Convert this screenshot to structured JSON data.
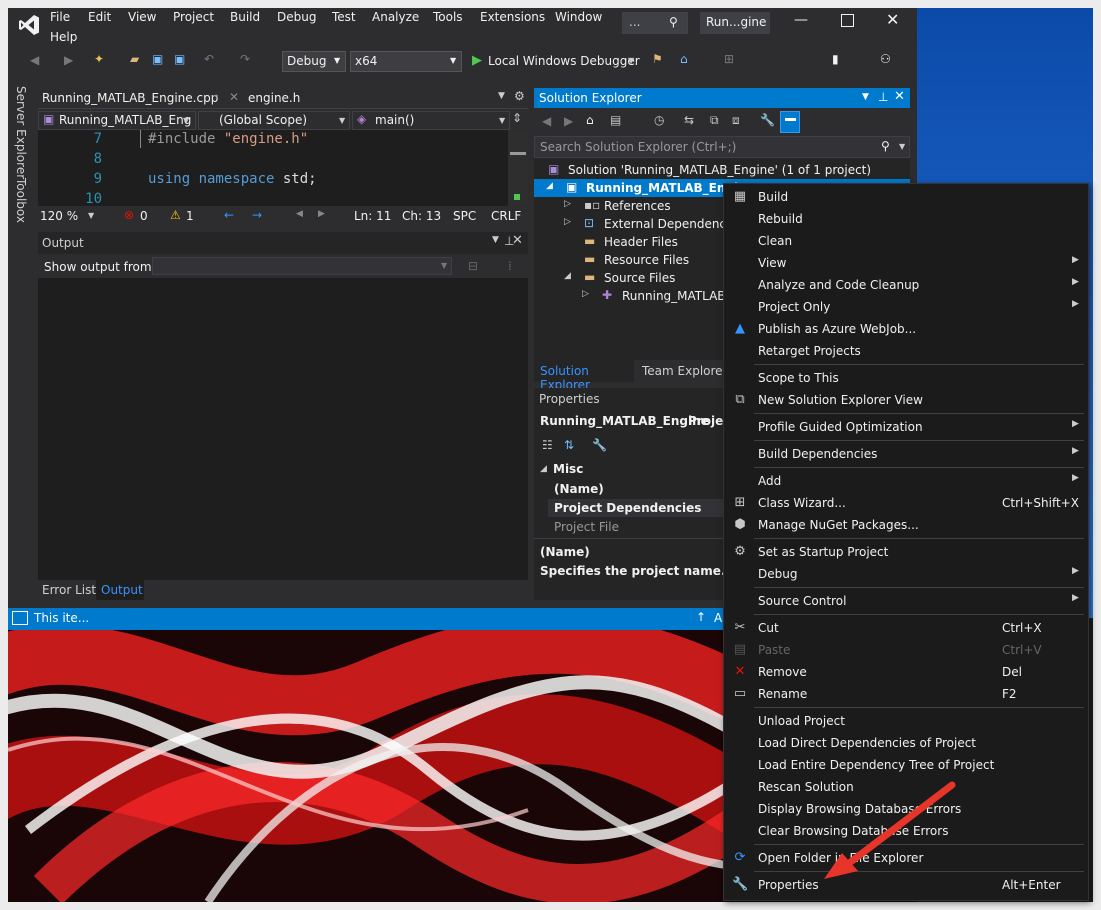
{
  "menu": {
    "items": [
      "File",
      "Edit",
      "View",
      "Project",
      "Build",
      "Debug",
      "Test",
      "Analyze",
      "Tools",
      "Extensions",
      "Window",
      "Help"
    ],
    "search_placeholder": "...",
    "window_title": "Run...gine"
  },
  "toolbar": {
    "config": "Debug",
    "platform": "x64",
    "debugger": "Local Windows Debugger"
  },
  "side_tabs": [
    "Server Explorer",
    "Toolbox"
  ],
  "editor": {
    "tabs": [
      "Running_MATLAB_Engine.cpp",
      "engine.h"
    ],
    "project_dropdown": "Running_MATLAB_Eng",
    "scope_dropdown": "(Global Scope)",
    "member_dropdown": "main()",
    "lines": [
      {
        "num": "7",
        "tokens": [
          {
            "t": "#include ",
            "c": "#9b9b9b"
          },
          {
            "t": "\"engine.h\"",
            "c": "#d69d85"
          }
        ]
      },
      {
        "num": "8",
        "tokens": []
      },
      {
        "num": "9",
        "tokens": [
          {
            "t": "using ",
            "c": "#569cd6"
          },
          {
            "t": "namespace ",
            "c": "#569cd6"
          },
          {
            "t": "std;",
            "c": "#dcdcdc"
          }
        ]
      },
      {
        "num": "10",
        "tokens": []
      }
    ],
    "status": {
      "zoom": "120 %",
      "errors": "0",
      "warnings": "1",
      "ln": "Ln: 11",
      "ch": "Ch: 13",
      "spc": "SPC",
      "crlf": "CRLF"
    }
  },
  "output": {
    "title": "Output",
    "show_from_label": "Show output from:",
    "tabs": [
      "Error List",
      "Output"
    ]
  },
  "solution_explorer": {
    "title": "Solution Explorer",
    "search_placeholder": "Search Solution Explorer (Ctrl+;)",
    "tree": [
      {
        "label": "Solution 'Running_MATLAB_Engine' (1 of 1 project)",
        "indent": 0,
        "icon": "solution-icon"
      },
      {
        "label": "Running_MATLAB_Engine",
        "indent": 1,
        "icon": "project-icon",
        "selected": true
      },
      {
        "label": "References",
        "indent": 2,
        "icon": "references-icon"
      },
      {
        "label": "External Dependencies",
        "indent": 2,
        "icon": "external-deps-icon"
      },
      {
        "label": "Header Files",
        "indent": 2,
        "icon": "folder-icon"
      },
      {
        "label": "Resource Files",
        "indent": 2,
        "icon": "folder-icon"
      },
      {
        "label": "Source Files",
        "indent": 2,
        "icon": "folder-icon"
      },
      {
        "label": "Running_MATLAB_",
        "indent": 3,
        "icon": "cpp-file-icon"
      }
    ],
    "tabs": [
      "Solution Explorer",
      "Team Explorer"
    ]
  },
  "properties": {
    "title": "Properties",
    "object": "Running_MATLAB_Engine",
    "object_type": "Project",
    "section": "Misc",
    "rows": [
      "(Name)",
      "Project Dependencies",
      "Project File"
    ],
    "desc_title": "(Name)",
    "desc_text": "Specifies the project name."
  },
  "taskbar": {
    "status": "This ite..."
  },
  "context_menu": {
    "groups": [
      [
        {
          "label": "Build",
          "icon": "build-icon"
        },
        {
          "label": "Rebuild"
        },
        {
          "label": "Clean"
        },
        {
          "label": "View",
          "submenu": true
        },
        {
          "label": "Analyze and Code Cleanup",
          "submenu": true
        },
        {
          "label": "Project Only",
          "submenu": true
        },
        {
          "label": "Publish as Azure WebJob...",
          "icon": "azure-icon"
        },
        {
          "label": "Retarget Projects"
        }
      ],
      [
        {
          "label": "Scope to This"
        },
        {
          "label": "New Solution Explorer View",
          "icon": "new-view-icon"
        }
      ],
      [
        {
          "label": "Profile Guided Optimization",
          "submenu": true
        }
      ],
      [
        {
          "label": "Build Dependencies",
          "submenu": true
        }
      ],
      [
        {
          "label": "Add",
          "submenu": true
        },
        {
          "label": "Class Wizard...",
          "shortcut": "Ctrl+Shift+X",
          "icon": "class-wizard-icon"
        },
        {
          "label": "Manage NuGet Packages...",
          "icon": "nuget-icon"
        }
      ],
      [
        {
          "label": "Set as Startup Project",
          "icon": "gear-icon"
        },
        {
          "label": "Debug",
          "submenu": true
        }
      ],
      [
        {
          "label": "Source Control",
          "submenu": true
        }
      ],
      [
        {
          "label": "Cut",
          "shortcut": "Ctrl+X",
          "icon": "scissors-icon"
        },
        {
          "label": "Paste",
          "shortcut": "Ctrl+V",
          "icon": "paste-icon",
          "disabled": true
        },
        {
          "label": "Remove",
          "shortcut": "Del",
          "icon": "remove-icon"
        },
        {
          "label": "Rename",
          "shortcut": "F2",
          "icon": "rename-icon"
        }
      ],
      [
        {
          "label": "Unload Project"
        },
        {
          "label": "Load Direct Dependencies of Project"
        },
        {
          "label": "Load Entire Dependency Tree of Project"
        },
        {
          "label": "Rescan Solution"
        },
        {
          "label": "Display Browsing Database Errors"
        },
        {
          "label": "Clear Browsing Database Errors"
        }
      ],
      [
        {
          "label": "Open Folder in File Explorer",
          "icon": "refresh-icon"
        }
      ],
      [
        {
          "label": "Properties",
          "shortcut": "Alt+Enter",
          "icon": "wrench-icon"
        }
      ]
    ]
  },
  "colors": {
    "accent": "#007acc",
    "menu_bg": "#1b1b1c",
    "remove_red": "#e51400",
    "annotation_arrow": "#e8352a"
  }
}
